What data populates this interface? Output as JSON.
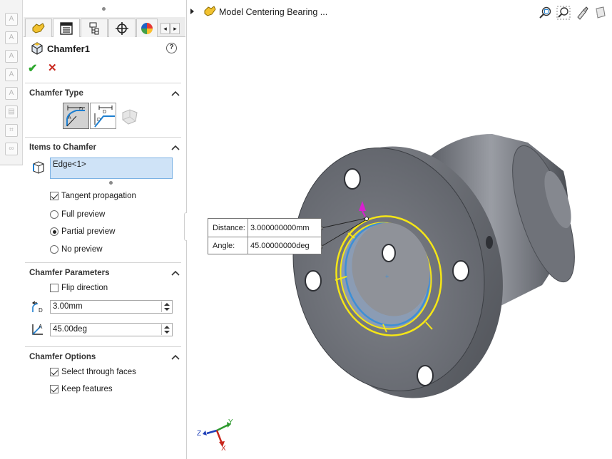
{
  "left_strip": {
    "icons": [
      "text-icon",
      "text-edit-icon",
      "text-check-icon",
      "text-add-icon",
      "text-lock-icon",
      "print-icon",
      "grid-icon",
      "link-icon"
    ]
  },
  "tabs": {
    "items": [
      "feature-manager-icon",
      "property-manager-icon",
      "configuration-manager-icon",
      "dimxpert-icon",
      "display-manager-icon"
    ],
    "scroll_left": "◂",
    "scroll_right": "▸"
  },
  "header": {
    "title": "Chamfer1",
    "help": "?",
    "ok": "✔",
    "cancel": "✕"
  },
  "chamfer_type": {
    "heading": "Chamfer Type",
    "options": [
      "angle-distance-icon",
      "distance-distance-icon",
      "vertex-icon"
    ],
    "selected": "angle-distance-icon"
  },
  "items_to_chamfer": {
    "heading": "Items to Chamfer",
    "list_value": "Edge<1>",
    "tangent_propagation": {
      "label": "Tangent propagation",
      "checked": true
    },
    "preview_options": [
      {
        "label": "Full preview",
        "checked": false
      },
      {
        "label": "Partial preview",
        "checked": true
      },
      {
        "label": "No preview",
        "checked": false
      }
    ]
  },
  "chamfer_parameters": {
    "heading": "Chamfer Parameters",
    "flip_direction": {
      "label": "Flip direction",
      "checked": false
    },
    "distance_value": "3.00mm",
    "angle_value": "45.00deg"
  },
  "chamfer_options": {
    "heading": "Chamfer Options",
    "select_through_faces": {
      "label": "Select through faces",
      "checked": true
    },
    "keep_features": {
      "label": "Keep features",
      "checked": true
    }
  },
  "graphics": {
    "document_title": "Model Centering Bearing ...",
    "view_icons": [
      "zoom-to-fit-icon",
      "zoom-area-icon",
      "previous-view-icon",
      "section-view-icon"
    ],
    "callout": {
      "distance_label": "Distance:",
      "distance_value": "3.000000000mm",
      "angle_label": "Angle:",
      "angle_value": "45.00000000deg"
    },
    "triad": {
      "x": "X",
      "y": "Y",
      "z": "Z"
    }
  },
  "colors": {
    "selection_yellow": "#f5e616",
    "edge_blue": "#3d8fd6",
    "part_gray": "#6e7178",
    "handle_magenta": "#d81fd0",
    "check_green": "#2ea82e",
    "cancel_red": "#c8261c"
  }
}
